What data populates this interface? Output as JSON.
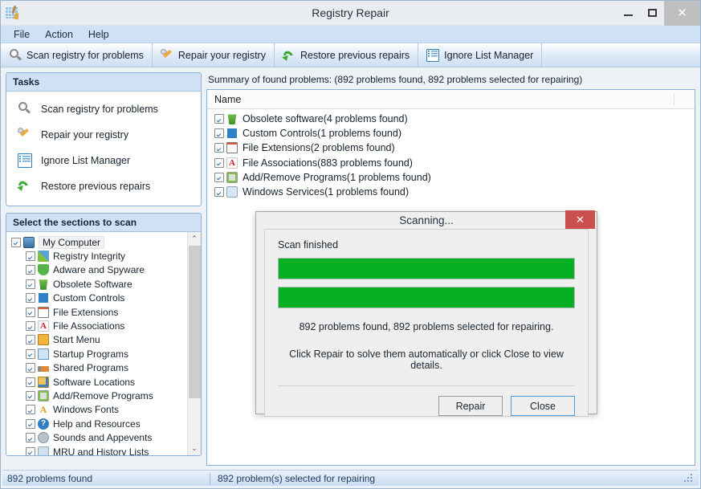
{
  "window": {
    "title": "Registry Repair",
    "app_icon": "registry-broom-icon",
    "minimize_label": "",
    "maximize_label": "",
    "close_label": "✕"
  },
  "menubar": {
    "items": [
      {
        "label": "File"
      },
      {
        "label": "Action"
      },
      {
        "label": "Help"
      }
    ]
  },
  "toolbar": {
    "buttons": [
      {
        "label": "Scan registry for problems",
        "icon": "magnifier-icon"
      },
      {
        "label": "Repair your registry",
        "icon": "wrench-icon"
      },
      {
        "label": "Restore previous repairs",
        "icon": "green-curved-arrow-icon"
      },
      {
        "label": "Ignore List Manager",
        "icon": "list-icon"
      }
    ]
  },
  "sidebar": {
    "tasks_panel": {
      "header": "Tasks",
      "items": [
        {
          "label": "Scan registry for problems",
          "icon": "magnifier-icon"
        },
        {
          "label": "Repair your registry",
          "icon": "wrench-icon"
        },
        {
          "label": "Ignore List Manager",
          "icon": "list-icon"
        },
        {
          "label": "Restore previous repairs",
          "icon": "green-curved-arrow-icon"
        }
      ]
    },
    "sections_panel": {
      "header": "Select the sections to scan",
      "root": {
        "label": "My Computer",
        "checked": true,
        "icon": "monitor-icon"
      },
      "items": [
        {
          "label": "Registry Integrity",
          "checked": true,
          "icon": "registry-blocks-icon"
        },
        {
          "label": "Adware and Spyware",
          "checked": true,
          "icon": "green-shield-icon"
        },
        {
          "label": "Obsolete Software",
          "checked": true,
          "icon": "recycle-bin-icon"
        },
        {
          "label": "Custom Controls",
          "checked": true,
          "icon": "blue-blocks-icon"
        },
        {
          "label": "File Extensions",
          "checked": true,
          "icon": "file-extension-icon"
        },
        {
          "label": "File Associations",
          "checked": true,
          "icon": "red-a-icon"
        },
        {
          "label": "Start Menu",
          "checked": true,
          "icon": "start-menu-icon"
        },
        {
          "label": "Startup Programs",
          "checked": true,
          "icon": "startup-window-icon"
        },
        {
          "label": "Shared Programs",
          "checked": true,
          "icon": "shared-programs-icon"
        },
        {
          "label": "Software Locations",
          "checked": true,
          "icon": "software-location-icon"
        },
        {
          "label": "Add/Remove Programs",
          "checked": true,
          "icon": "addremove-icon"
        },
        {
          "label": "Windows Fonts",
          "checked": true,
          "icon": "font-icon"
        },
        {
          "label": "Help and Resources",
          "checked": true,
          "icon": "help-question-icon"
        },
        {
          "label": "Sounds and Appevents",
          "checked": true,
          "icon": "sound-icon"
        },
        {
          "label": "MRU and History Lists",
          "checked": true,
          "icon": "history-icon"
        }
      ],
      "scroll_up": "⌃",
      "scroll_down": "⌄"
    }
  },
  "main": {
    "summary": "Summary of found problems: (892 problems found, 892 problems selected for repairing)",
    "columns": [
      {
        "label": "Name"
      },
      {
        "label": ""
      }
    ],
    "rows": [
      {
        "label": "Obsolete software(4 problems found)",
        "checked": true,
        "icon": "recycle-bin-icon"
      },
      {
        "label": "Custom Controls(1 problems found)",
        "checked": true,
        "icon": "blue-blocks-icon"
      },
      {
        "label": "File Extensions(2 problems found)",
        "checked": true,
        "icon": "file-extension-icon"
      },
      {
        "label": "File Associations(883 problems found)",
        "checked": true,
        "icon": "red-a-icon"
      },
      {
        "label": "Add/Remove Programs(1 problems found)",
        "checked": true,
        "icon": "addremove-icon"
      },
      {
        "label": "Windows Services(1 problems found)",
        "checked": true,
        "icon": "services-icon"
      }
    ]
  },
  "statusbar": {
    "left": "892 problems found",
    "right": "892 problem(s) selected for repairing"
  },
  "dialog": {
    "title": "Scanning...",
    "close_label": "✕",
    "scan_status": "Scan finished",
    "progress": [
      {
        "name": "overall-progress",
        "percent": 100
      },
      {
        "name": "section-progress",
        "percent": 100
      }
    ],
    "message_1": "892 problems found, 892 problems selected for repairing.",
    "message_2": "Click Repair to solve them automatically or click Close to view details.",
    "buttons": [
      {
        "label": "Repair",
        "focused": false
      },
      {
        "label": "Close",
        "focused": true
      }
    ]
  },
  "colors": {
    "progress_green": "#06b025",
    "dialog_close_red": "#c9504f",
    "accent_blue": "#cfe1f5",
    "panel_border": "#8ab0d6"
  }
}
